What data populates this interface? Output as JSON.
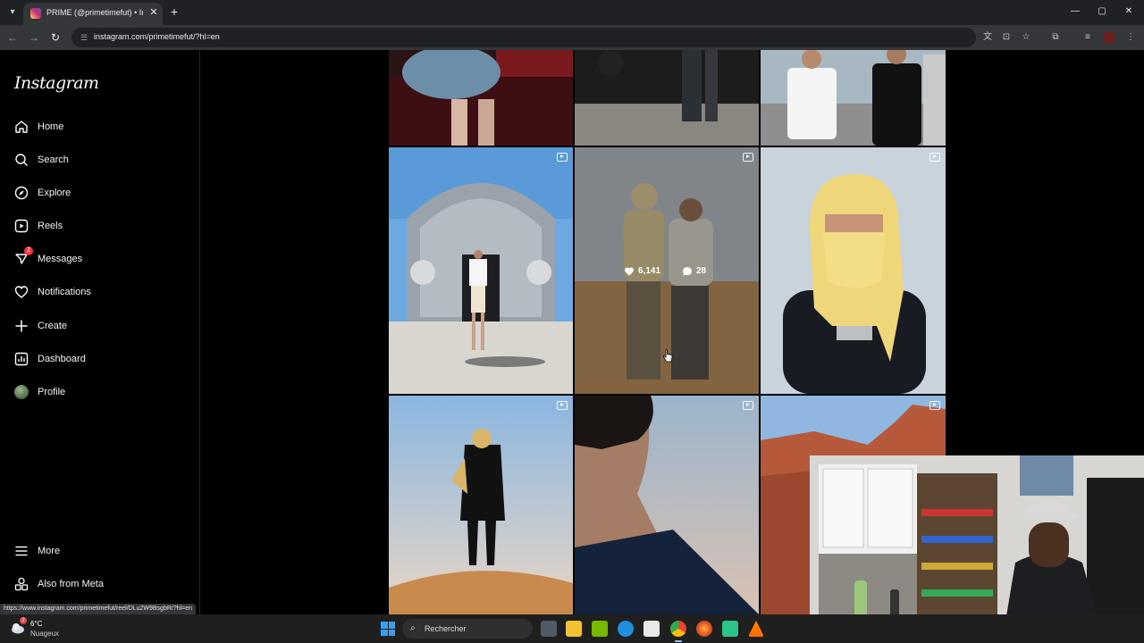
{
  "browser": {
    "tab_title": "PRIME (@primetimefut) • Instagram",
    "tab_close": "✕",
    "new_tab": "+",
    "url": "instagram.com/primetimefut/?hl=en",
    "status_url": "https://www.instagram.com/primetimefut/reel/DLu2W9BsgbR/?hl=en",
    "window_controls": [
      "—",
      "▢",
      "✕"
    ]
  },
  "sidebar": {
    "logo": "Instagram",
    "items": [
      {
        "label": "Home",
        "icon": "home-icon"
      },
      {
        "label": "Search",
        "icon": "search-icon"
      },
      {
        "label": "Explore",
        "icon": "compass-icon"
      },
      {
        "label": "Reels",
        "icon": "reels-icon"
      },
      {
        "label": "Messages",
        "icon": "messenger-icon",
        "badge": "2"
      },
      {
        "label": "Notifications",
        "icon": "heart-icon"
      },
      {
        "label": "Create",
        "icon": "plus-icon"
      },
      {
        "label": "Dashboard",
        "icon": "dashboard-icon"
      },
      {
        "label": "Profile",
        "icon": "avatar"
      }
    ],
    "more": "More",
    "meta": "Also from Meta"
  },
  "grid": {
    "hover_post": {
      "likes": "6,141",
      "comments": "28"
    }
  },
  "taskbar": {
    "weather_temp": "6°C",
    "weather_desc": "Nuageux",
    "weather_badge": "2",
    "search_placeholder": "Rechercher"
  },
  "colors": {
    "instagram_bg": "#000000",
    "badge": "#ff3040",
    "browser_chrome": "#35363a"
  }
}
